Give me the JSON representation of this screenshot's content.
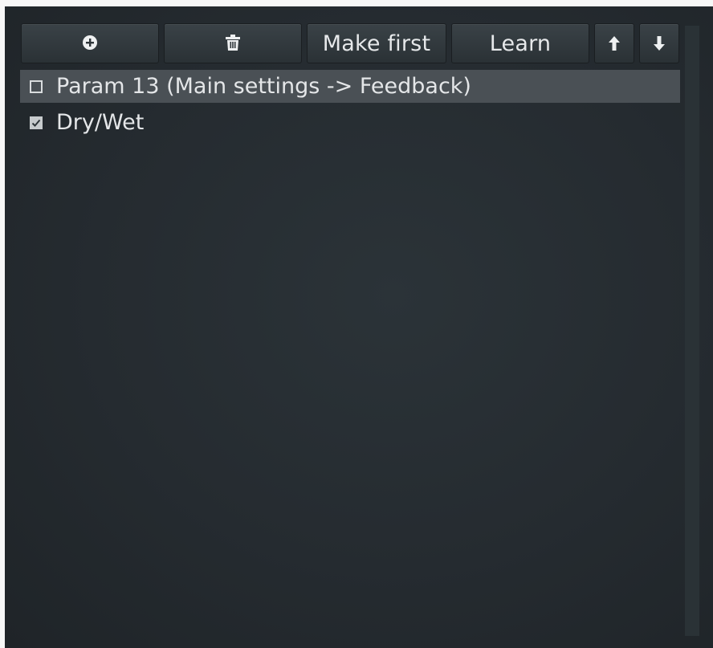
{
  "toolbar": {
    "add_icon": "add-circle-icon",
    "delete_icon": "trash-icon",
    "make_first_label": "Make first",
    "learn_label": "Learn",
    "up_icon": "arrow-up-icon",
    "down_icon": "arrow-down-icon"
  },
  "list": {
    "items": [
      {
        "label": "Param 13 (Main settings -> Feedback)",
        "checked": false,
        "selected": true
      },
      {
        "label": "Dry/Wet",
        "checked": true,
        "selected": false
      }
    ]
  },
  "colors": {
    "panel_bg": "#252b30",
    "button_bg": "#323a3f",
    "selected_row": "#4a5055",
    "text": "#e4e6e8"
  }
}
